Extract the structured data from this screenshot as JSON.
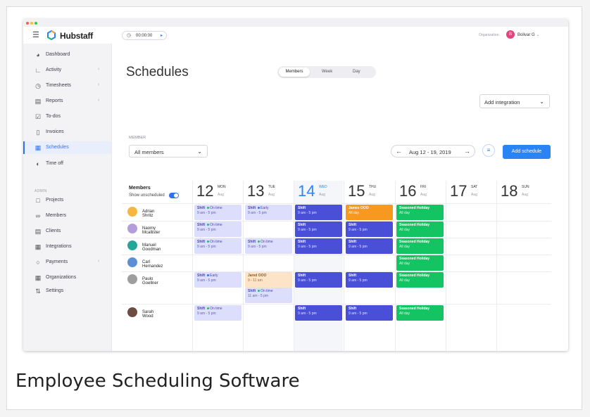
{
  "app": {
    "name": "Hubstaff"
  },
  "timer": {
    "value": "00:00:00"
  },
  "organization": {
    "label": "Organization:",
    "avatar_letter": "B",
    "name": "Bolivar G"
  },
  "sidebar": {
    "items": [
      {
        "label": "Dashboard",
        "icon": "dashboard-icon"
      },
      {
        "label": "Activity",
        "icon": "activity-icon"
      },
      {
        "label": "Timesheets",
        "icon": "clock-icon"
      },
      {
        "label": "Reports",
        "icon": "report-icon"
      },
      {
        "label": "To-dos",
        "icon": "checkbox-icon"
      },
      {
        "label": "Invoices",
        "icon": "invoice-icon"
      },
      {
        "label": "Schedules",
        "icon": "calendar-icon"
      },
      {
        "label": "Time off",
        "icon": "time-off-icon"
      },
      {
        "label": "Projects",
        "icon": "folder-icon"
      },
      {
        "label": "Members",
        "icon": "members-icon"
      },
      {
        "label": "Clients",
        "icon": "clients-icon"
      },
      {
        "label": "Integrations",
        "icon": "integrations-icon"
      },
      {
        "label": "Payments",
        "icon": "payments-icon"
      },
      {
        "label": "Organizations",
        "icon": "organizations-icon"
      },
      {
        "label": "Settings",
        "icon": "settings-icon"
      }
    ],
    "admin_label": "ADMIN"
  },
  "page": {
    "title": "Schedules",
    "view_toggle": [
      "Members",
      "Week",
      "Day"
    ],
    "integration": "Add integration",
    "member_label": "MEMBER",
    "member_value": "All members",
    "date_range": "Aug 12 - 19, 2019",
    "add_schedule": "Add schedule"
  },
  "grid": {
    "members_header": "Members",
    "show_unscheduled": "Show unscheduled",
    "days": [
      {
        "num": "12",
        "name": "MON",
        "month": "Aug"
      },
      {
        "num": "13",
        "name": "TUE",
        "month": "Aug"
      },
      {
        "num": "14",
        "name": "WED",
        "month": "Aug"
      },
      {
        "num": "15",
        "name": "THU",
        "month": "Aug"
      },
      {
        "num": "16",
        "name": "FRI",
        "month": "Aug"
      },
      {
        "num": "17",
        "name": "SAT",
        "month": "Aug"
      },
      {
        "num": "18",
        "name": "SUN",
        "month": "Aug"
      }
    ],
    "members": [
      "Adrian Shritz",
      "Naomy Mcallister",
      "Manuel Goodman",
      "Carl Hernandez",
      "Paulo Goellner",
      "Sarah Wood"
    ],
    "shift_text": "Shift",
    "time_text": "9 am - 5 pm",
    "status": {
      "on_time": "On time",
      "early": "Early"
    },
    "status_colors": {
      "on_time": "#14c361",
      "early": "#2b73f4"
    },
    "ooo": "James OOO",
    "all_day": "All day",
    "holiday": "Seasoned Holiday",
    "jared": "Jared OOO",
    "jared_time": "9 - 11 am",
    "late_time": "11 am - 5 pm"
  },
  "caption": "Employee Scheduling Software",
  "colors": {
    "accent": "#2b73f4",
    "shift_blue": "#4a4fd8",
    "green": "#14c361",
    "orange": "#f7991f"
  }
}
